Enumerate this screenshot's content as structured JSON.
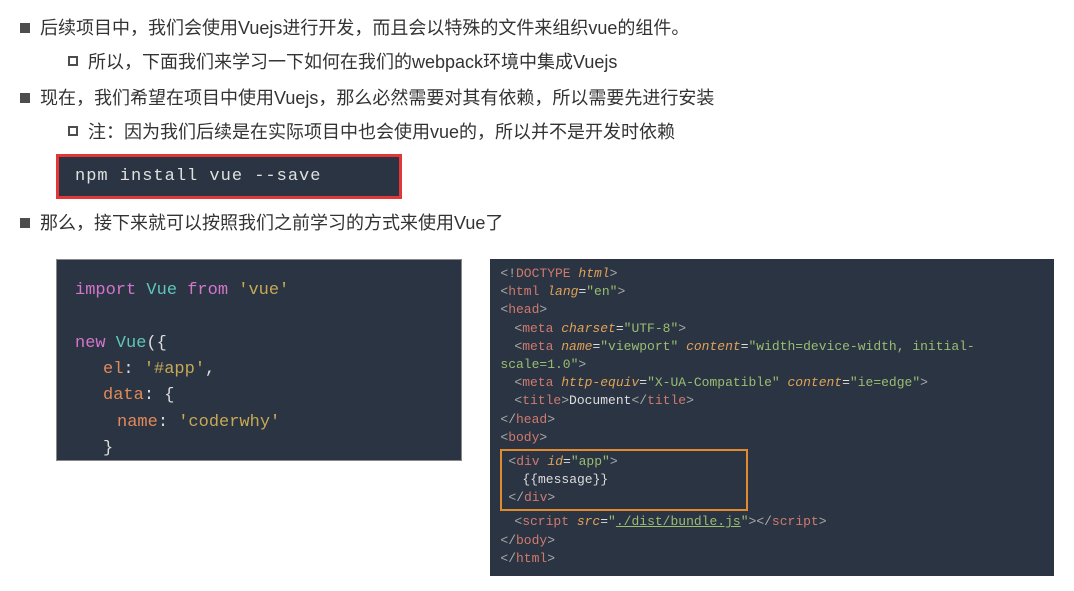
{
  "bullets": {
    "b1": "后续项目中，我们会使用Vuejs进行开发，而且会以特殊的文件来组织vue的组件。",
    "b1a": "所以，下面我们来学习一下如何在我们的webpack环境中集成Vuejs",
    "b2": "现在，我们希望在项目中使用Vuejs，那么必然需要对其有依赖，所以需要先进行安装",
    "b2a": "注：因为我们后续是在实际项目中也会使用vue的，所以并不是开发时依赖",
    "b3": "那么，接下来就可以按照我们之前学习的方式来使用Vue了"
  },
  "cmd": "npm install vue --save",
  "code_left": {
    "l1_import": "import",
    "l1_vue": " Vue ",
    "l1_from": "from",
    "l1_str": "'vue'",
    "l2_new": "new",
    "l2_vue": " Vue",
    "l2_paren": "({",
    "l3_el_k": "el",
    "l3_colon": ": ",
    "l3_el_v": "'#app'",
    "l3_comma": ",",
    "l4_data_k": "data",
    "l4_colon": ": {",
    "l5_name_k": "name",
    "l5_colon": ": ",
    "l5_name_v": "'coderwhy'",
    "l6_close": "}",
    "l7_close": "})"
  },
  "code_right": {
    "doctype_open": "<!",
    "doctype": "DOCTYPE ",
    "doctype_html": "html",
    "doctype_close": ">",
    "tag_open": "<",
    "tag_close": ">",
    "tag_slash": "</",
    "html": "html",
    "lang_attr": " lang",
    "eq": "=",
    "lang_val": "\"en\"",
    "head": "head",
    "meta": "meta",
    "charset_attr": " charset",
    "charset_val": "\"UTF-8\"",
    "name_attr": " name",
    "viewport_val": "\"viewport\"",
    "content_attr": " content",
    "vp_content_val": "\"width=device-width, initial-scale=1.0\"",
    "httpequiv_attr": " http-equiv",
    "httpequiv_val": "\"X-UA-Compatible\"",
    "ie_val": "\"ie=edge\"",
    "title": "title",
    "title_text": "Document",
    "body": "body",
    "div": "div",
    "id_attr": " id",
    "app_val": "\"app\"",
    "msg": "{{message}}",
    "script": "script",
    "src_attr": " src",
    "src_val": "\"",
    "src_path": "./dist/bundle.js",
    "src_val_end": "\""
  }
}
